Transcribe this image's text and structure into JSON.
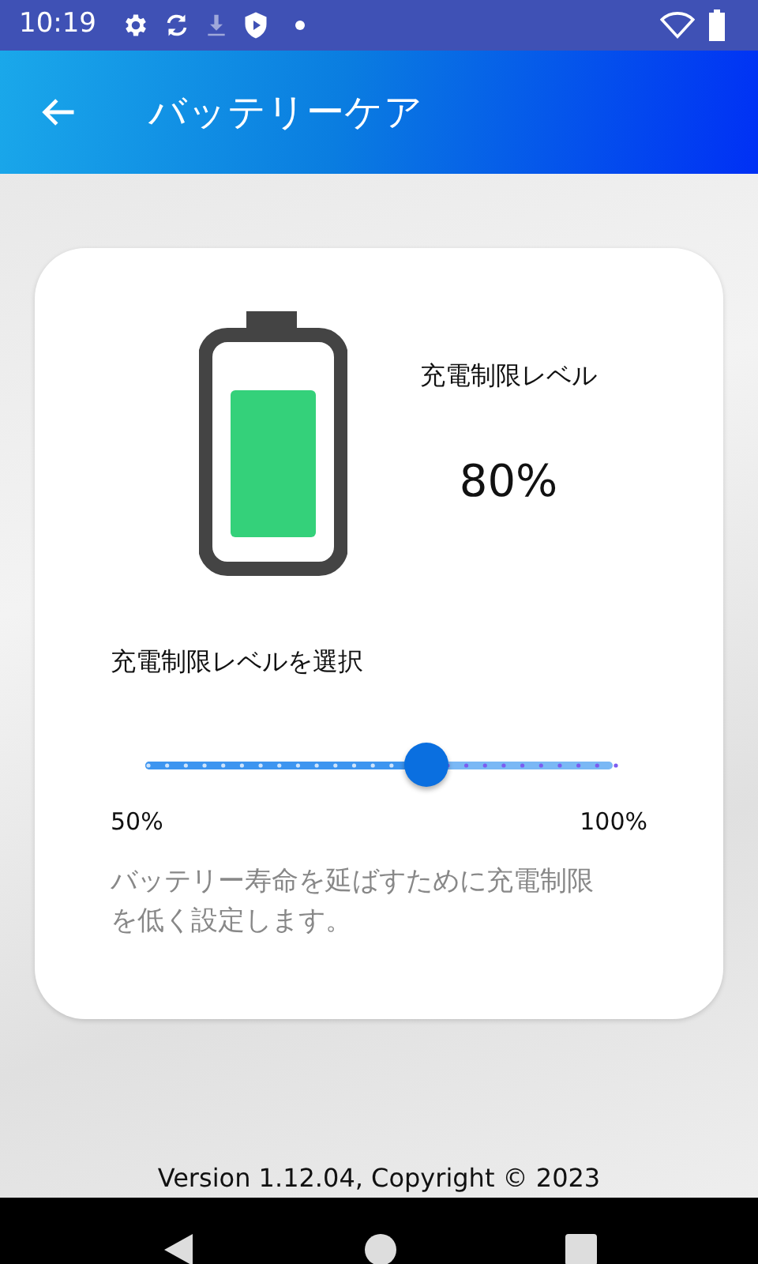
{
  "status_bar": {
    "time": "10:19"
  },
  "app_bar": {
    "title": "バッテリーケア"
  },
  "card": {
    "limit_label": "充電制限レベル",
    "limit_value": "80%",
    "select_label": "充電制限レベルを選択",
    "slider": {
      "level": 0.6,
      "min_label": "50%",
      "max_label": "100%"
    },
    "description": "バッテリー寿命を延ばすために充電制限を低く設定します。"
  },
  "footer": "Version 1.12.04, Copyright © 2023"
}
